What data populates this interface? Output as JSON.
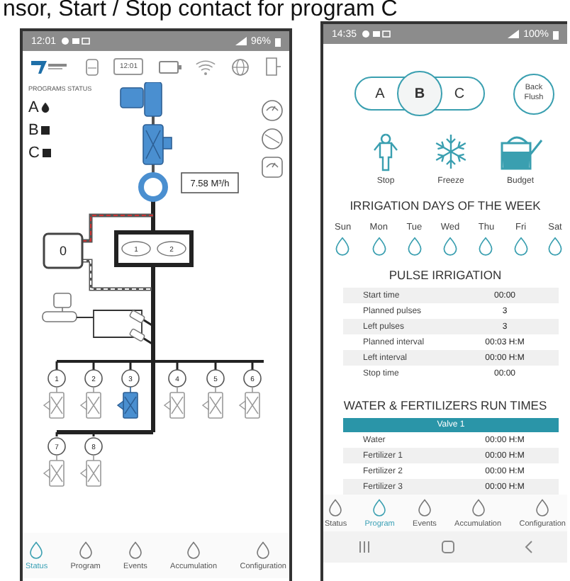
{
  "caption": "nsor, Start / Stop contact for program C",
  "status_phone": {
    "status_bar": {
      "time": "12:01",
      "battery": "96%"
    },
    "header": {
      "clock": "12:01"
    },
    "programs_status": {
      "title": "PROGRAMS STATUS",
      "programs": [
        {
          "label": "A",
          "running": true
        },
        {
          "label": "B",
          "running": false
        },
        {
          "label": "C",
          "running": false
        }
      ]
    },
    "diagram": {
      "flow": "7.58 M³/h",
      "counter": "0",
      "filters": [
        "1",
        "2"
      ],
      "valves": [
        {
          "label": "1",
          "on": false
        },
        {
          "label": "2",
          "on": false
        },
        {
          "label": "3",
          "on": true
        },
        {
          "label": "4",
          "on": false
        },
        {
          "label": "5",
          "on": false
        },
        {
          "label": "6",
          "on": false
        },
        {
          "label": "7",
          "on": false
        },
        {
          "label": "8",
          "on": false
        }
      ]
    },
    "nav": [
      {
        "label": "Status",
        "selected": true
      },
      {
        "label": "Program",
        "selected": false
      },
      {
        "label": "Events",
        "selected": false
      },
      {
        "label": "Accumulation",
        "selected": false
      },
      {
        "label": "Configuration",
        "selected": false
      }
    ]
  },
  "program_phone": {
    "status_bar": {
      "time": "14:35",
      "battery": "100%"
    },
    "programs": [
      {
        "label": "A",
        "selected": false
      },
      {
        "label": "B",
        "selected": true
      },
      {
        "label": "C",
        "selected": false
      }
    ],
    "back_flush": "Back Flush",
    "actions": [
      {
        "kind": "stop",
        "label": "Stop"
      },
      {
        "kind": "freeze",
        "label": "Freeze"
      },
      {
        "kind": "budget",
        "label": "Budget"
      }
    ],
    "days_title": "IRRIGATION DAYS OF THE WEEK",
    "days": [
      {
        "label": "Sun",
        "irrigate": false
      },
      {
        "label": "Mon",
        "irrigate": false
      },
      {
        "label": "Tue",
        "irrigate": false
      },
      {
        "label": "Wed",
        "irrigate": false
      },
      {
        "label": "Thu",
        "irrigate": false
      },
      {
        "label": "Fri",
        "irrigate": false
      },
      {
        "label": "Sat",
        "irrigate": false
      }
    ],
    "pulse": {
      "title": "PULSE IRRIGATION",
      "rows": [
        {
          "label": "Start time",
          "value": "00:00"
        },
        {
          "label": "Planned pulses",
          "value": "3"
        },
        {
          "label": "Left pulses",
          "value": "3"
        },
        {
          "label": "Planned interval",
          "value": "00:03 H:M"
        },
        {
          "label": "Left interval",
          "value": "00:00 H:M"
        },
        {
          "label": "Stop time",
          "value": "00:00"
        }
      ]
    },
    "run_times": {
      "title": "WATER & FERTILIZERS RUN TIMES",
      "valve": "Valve 1",
      "rows": [
        {
          "label": "Water",
          "value": "00:00 H:M"
        },
        {
          "label": "Fertilizer 1",
          "value": "00:00 H:M"
        },
        {
          "label": "Fertilizer 2",
          "value": "00:00 H:M"
        },
        {
          "label": "Fertilizer 3",
          "value": "00:00 H:M"
        }
      ]
    },
    "nav": [
      {
        "label": "Status",
        "selected": false
      },
      {
        "label": "Program",
        "selected": true
      },
      {
        "label": "Events",
        "selected": false
      },
      {
        "label": "Accumulation",
        "selected": false
      },
      {
        "label": "Configuration",
        "selected": false
      }
    ]
  }
}
